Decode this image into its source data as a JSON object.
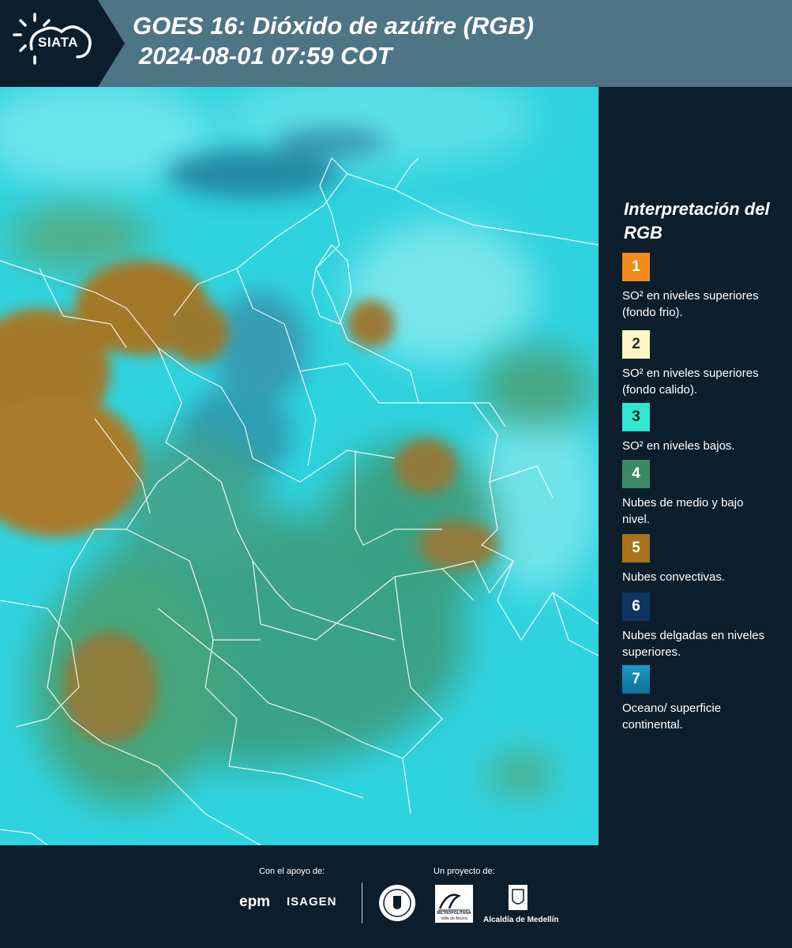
{
  "header": {
    "logo_text": "SIATA",
    "title_line1": "GOES 16: Dióxido de azúfre (RGB)",
    "title_line2": "2024-08-01 07:59 COT"
  },
  "legend": {
    "title": "Interpretación del RGB",
    "items": [
      {
        "num": "1",
        "color": "#f28b1a",
        "label": "SO² en niveles superiores (fondo frio)."
      },
      {
        "num": "2",
        "color": "#fdf6c4",
        "label": "SO² en niveles superiores (fondo calido)."
      },
      {
        "num": "3",
        "color": "#2ee8d2",
        "label": "SO² en niveles bajos."
      },
      {
        "num": "4",
        "color": "#3b8a63",
        "label": "Nubes de medio y bajo nivel."
      },
      {
        "num": "5",
        "color": "#a8731a",
        "label": "Nubes convectivas."
      },
      {
        "num": "6",
        "color": "#0d3560",
        "label": "Nubes delgadas en niveles superiores."
      },
      {
        "num": "7",
        "color": "#1d8fb8",
        "label": "Oceano/ superficie continental."
      }
    ]
  },
  "footer": {
    "support_label": "Con el apoyo de:",
    "project_label": "Un proyecto de:",
    "epm": "epm",
    "isagen": "ISAGEN",
    "area_text": "METROPOLITANA",
    "area_sub": "Valle de Aburrá",
    "alcaldia": "Alcaldía de Medellín"
  },
  "colors": {
    "background": "#0c1e2c",
    "header_band": "#4e7585",
    "map_base": "#2fd2df"
  }
}
